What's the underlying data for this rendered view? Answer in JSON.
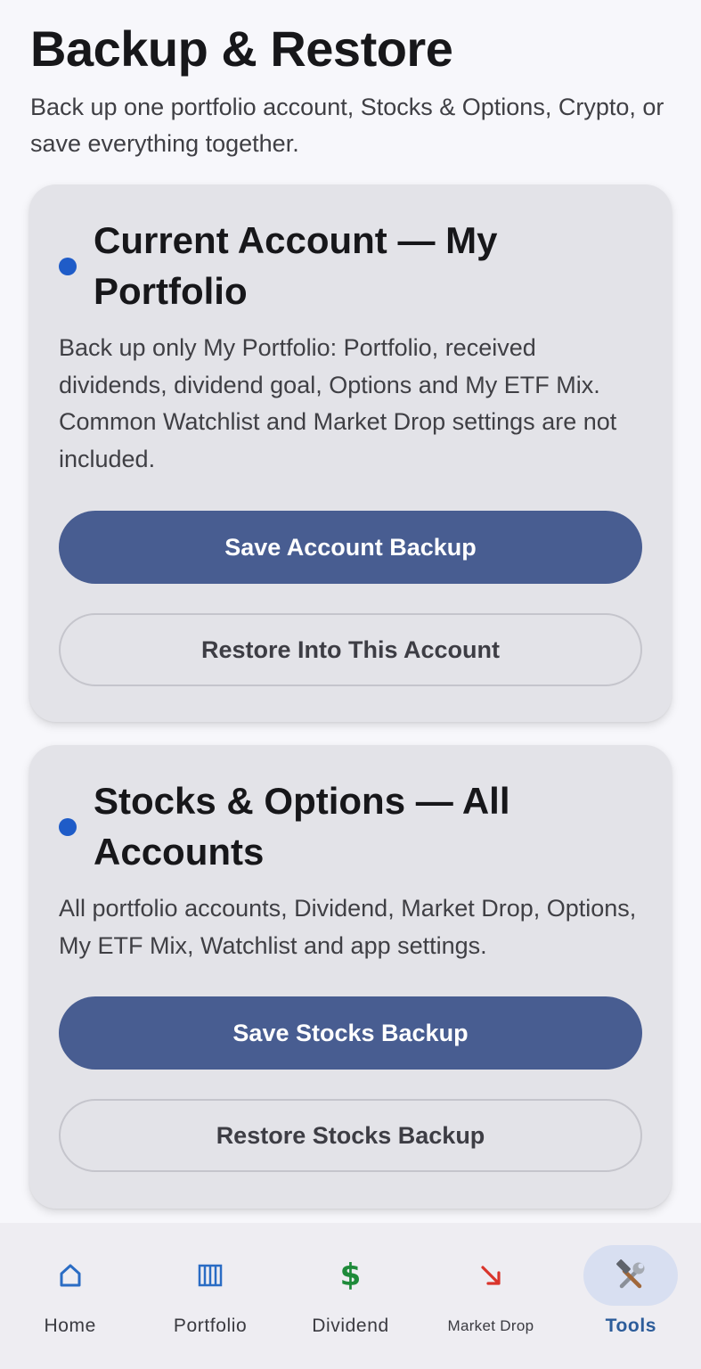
{
  "page": {
    "title": "Backup & Restore",
    "subtitle": "Back up one portfolio account, Stocks & Options, Crypto, or save everything together."
  },
  "cards": [
    {
      "title": "Current Account — My Portfolio",
      "description": "Back up only My Portfolio: Portfolio, received dividends, dividend goal, Options and My ETF Mix. Common Watchlist and Market Drop settings are not included.",
      "primary_button": "Save Account Backup",
      "secondary_button": "Restore Into This Account"
    },
    {
      "title": "Stocks & Options — All Accounts",
      "description": "All portfolio accounts, Dividend, Market Drop, Options, My ETF Mix, Watchlist and app settings.",
      "primary_button": "Save Stocks Backup",
      "secondary_button": "Restore Stocks Backup"
    }
  ],
  "nav": {
    "items": [
      {
        "label": "Home",
        "icon": "home-icon",
        "active": false
      },
      {
        "label": "Portfolio",
        "icon": "columns-icon",
        "active": false
      },
      {
        "label": "Dividend",
        "icon": "dollar-icon",
        "dollar_glyph": "$",
        "active": false
      },
      {
        "label": "Market Drop",
        "icon": "arrow-down-right-icon",
        "active": false
      },
      {
        "label": "Tools",
        "icon": "hammer-wrench-icon",
        "active": true
      }
    ]
  },
  "colors": {
    "accent": "#485d91",
    "dot": "#1f5cc8",
    "active_nav": "#2c5c9a",
    "dollar": "#1e8a3a",
    "arrow": "#d9342b"
  }
}
